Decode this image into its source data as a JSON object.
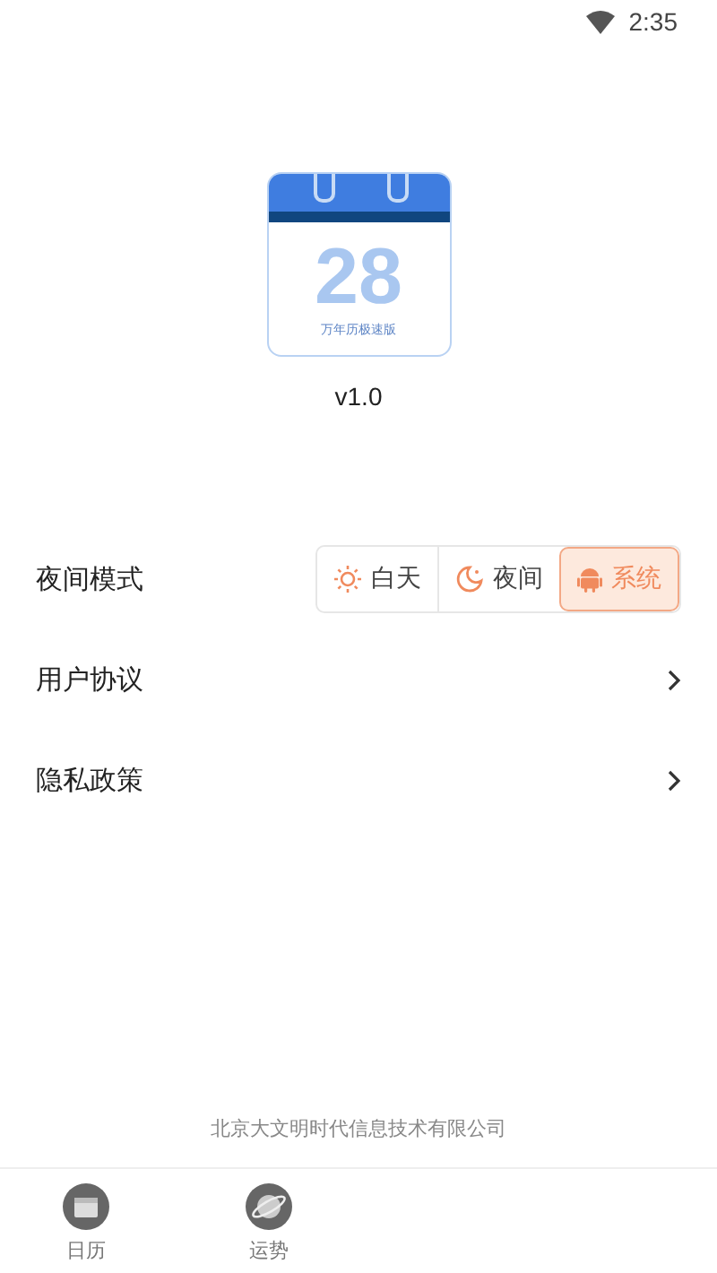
{
  "status_bar": {
    "time": "2:35"
  },
  "app": {
    "logo_day": "28",
    "logo_caption": "万年历极速版",
    "version": "v1.0"
  },
  "settings": [
    {
      "kind": "segmented",
      "label": "夜间模式",
      "options": [
        {
          "label": "白天",
          "kind": "sun",
          "selected": false
        },
        {
          "label": "夜间",
          "kind": "moon",
          "selected": false
        },
        {
          "label": "系统",
          "kind": "android",
          "selected": true
        }
      ]
    },
    {
      "kind": "link",
      "label": "用户协议"
    },
    {
      "kind": "link",
      "label": "隐私政策"
    }
  ],
  "footer": {
    "company": "北京大文明时代信息技术有限公司"
  },
  "bottom_nav": [
    {
      "label": "日历",
      "kind": "calendar"
    },
    {
      "label": "运势",
      "kind": "planet"
    }
  ]
}
